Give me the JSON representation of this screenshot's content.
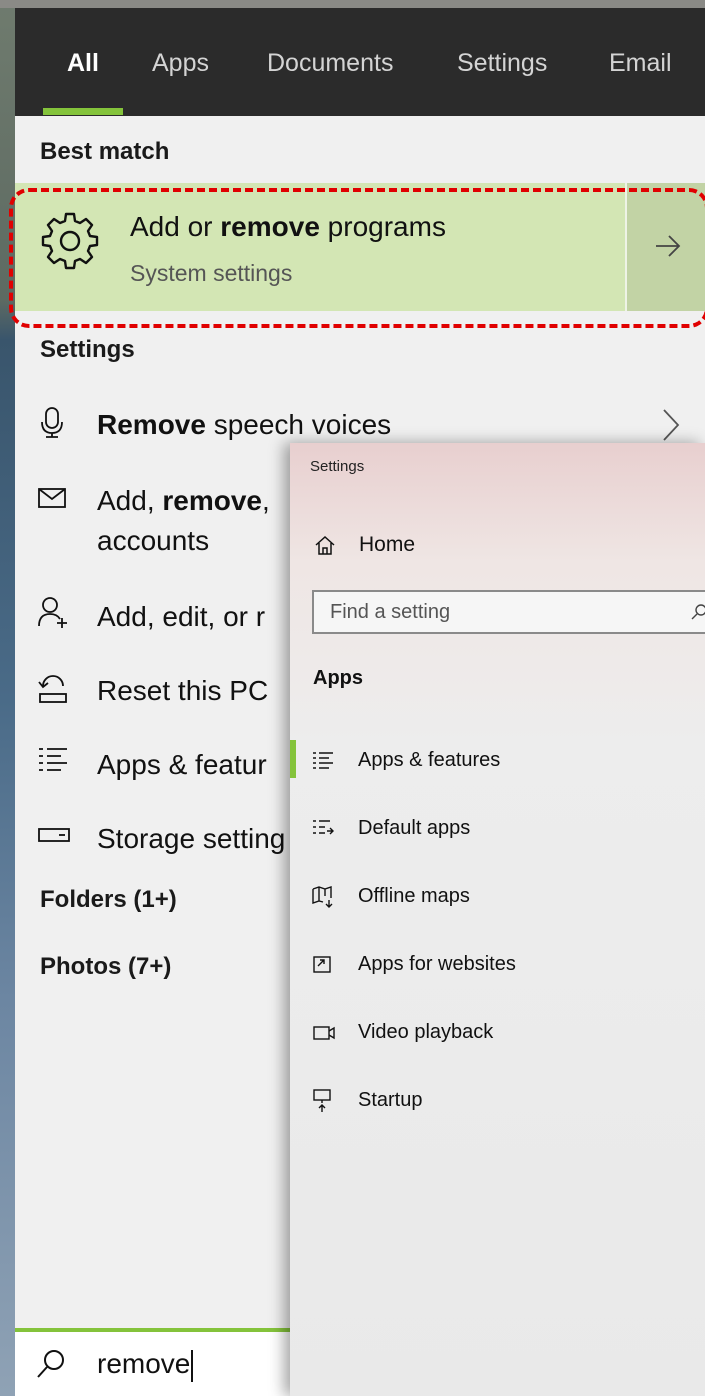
{
  "tabs": [
    {
      "label": "All",
      "active": true
    },
    {
      "label": "Apps"
    },
    {
      "label": "Documents"
    },
    {
      "label": "Settings"
    },
    {
      "label": "Email"
    }
  ],
  "best_match": {
    "heading": "Best match",
    "title_prefix": "Add or ",
    "title_bold": "remove",
    "title_suffix": " programs",
    "subtitle": "System settings",
    "icon": "gear-icon",
    "highlight_color": "#e00000"
  },
  "settings_section": {
    "heading": "Settings",
    "items": [
      {
        "bold": "Remove",
        "text": " speech voices",
        "icon": "microphone-icon"
      },
      {
        "prefix": "Add, ",
        "bold": "remove",
        "text": ",",
        "line2": "accounts",
        "icon": "mail-icon"
      },
      {
        "prefix": "Add, edit, or r",
        "icon": "person-add-icon"
      },
      {
        "prefix": "Reset this PC",
        "icon": "reset-icon"
      },
      {
        "prefix": "Apps & featur",
        "icon": "apps-list-icon"
      },
      {
        "prefix": "Storage setting",
        "icon": "storage-icon"
      }
    ]
  },
  "folders": {
    "label": "Folders (1+)"
  },
  "photos": {
    "label": "Photos (7+)"
  },
  "search": {
    "value": "remove"
  },
  "settings_window": {
    "title": "Settings",
    "home": "Home",
    "search_placeholder": "Find a setting",
    "section": "Apps",
    "items": [
      {
        "label": "Apps & features",
        "icon": "apps-features-icon",
        "selected": true
      },
      {
        "label": "Default apps",
        "icon": "default-apps-icon"
      },
      {
        "label": "Offline maps",
        "icon": "offline-maps-icon"
      },
      {
        "label": "Apps for websites",
        "icon": "apps-websites-icon"
      },
      {
        "label": "Video playback",
        "icon": "video-playback-icon"
      },
      {
        "label": "Startup",
        "icon": "startup-icon"
      }
    ]
  },
  "colors": {
    "accent": "#84c33b",
    "tabbar": "#2b2b2b",
    "best_match_bg": "#d3e6b4"
  }
}
